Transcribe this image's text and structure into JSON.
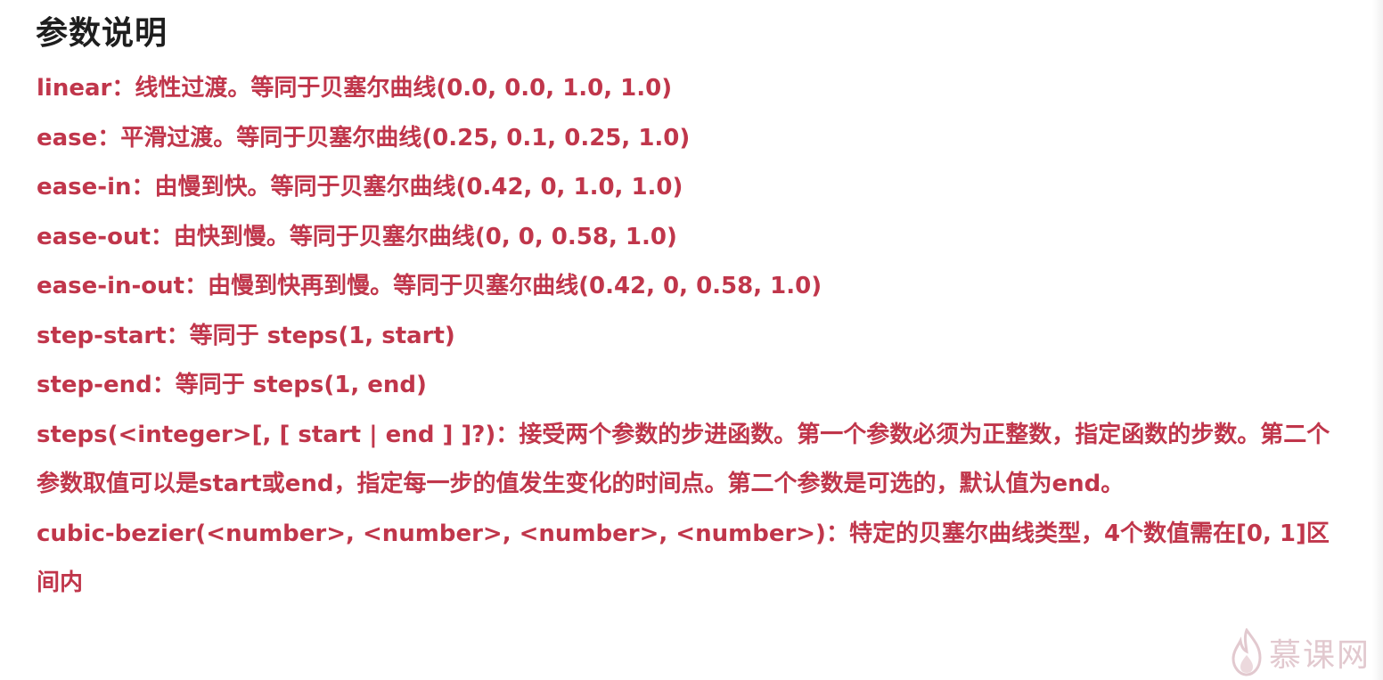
{
  "title": "参数说明",
  "items": [
    {
      "text": "linear：线性过渡。等同于贝塞尔曲线(0.0, 0.0, 1.0, 1.0)"
    },
    {
      "text": "ease：平滑过渡。等同于贝塞尔曲线(0.25, 0.1, 0.25, 1.0)"
    },
    {
      "text": "ease-in：由慢到快。等同于贝塞尔曲线(0.42, 0, 1.0, 1.0)"
    },
    {
      "text": "ease-out：由快到慢。等同于贝塞尔曲线(0, 0, 0.58, 1.0)"
    },
    {
      "text": "ease-in-out：由慢到快再到慢。等同于贝塞尔曲线(0.42, 0, 0.58, 1.0)"
    },
    {
      "text": "step-start：等同于 steps(1, start)"
    },
    {
      "text": "step-end：等同于 steps(1, end)"
    },
    {
      "text": "steps(<integer>[, [ start | end ] ]?)：接受两个参数的步进函数。第一个参数必须为正整数，指定函数的步数。第二个参数取值可以是start或end，指定每一步的值发生变化的时间点。第二个参数是可选的，默认值为end。"
    },
    {
      "text": "cubic-bezier(<number>, <number>, <number>, <number>)：特定的贝塞尔曲线类型，4个数值需在[0, 1]区间内"
    }
  ],
  "watermark": {
    "text": "慕课网",
    "icon": "flame-icon"
  },
  "colors": {
    "text": "#c0364b",
    "title": "#1e1e1e",
    "watermark": "#e2c9cf"
  }
}
